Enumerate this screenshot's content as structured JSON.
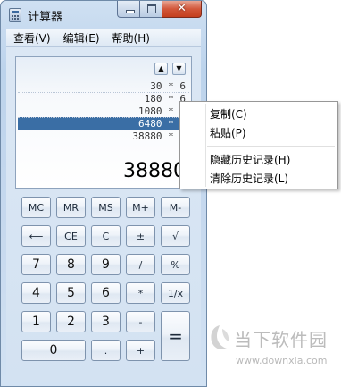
{
  "window": {
    "title": "计算器",
    "caption": {
      "minimize": "",
      "maximize": "",
      "close": "✕"
    }
  },
  "menubar": [
    {
      "label": "查看(V)"
    },
    {
      "label": "编辑(E)"
    },
    {
      "label": "帮助(H)"
    }
  ],
  "display": {
    "history_up": "▲",
    "history_down": "▼",
    "history": [
      "30 * 6",
      "180 * 6",
      "1080 * 6",
      "6480 * 6",
      "38880 * 6"
    ],
    "selected_index": 3,
    "result": "38880"
  },
  "keypad": {
    "rows": [
      [
        "MC",
        "MR",
        "MS",
        "M+",
        "M-"
      ],
      [
        "⟵",
        "CE",
        "C",
        "±",
        "√"
      ],
      [
        "7",
        "8",
        "9",
        "/",
        "%"
      ],
      [
        "4",
        "5",
        "6",
        "*",
        "1/x"
      ],
      [
        "1",
        "2",
        "3",
        "-",
        "="
      ],
      [
        "0",
        ".",
        "+"
      ]
    ]
  },
  "context_menu": {
    "items": [
      "复制(C)",
      "粘贴(P)",
      "隐藏历史记录(H)",
      "清除历史记录(L)"
    ]
  },
  "watermark": {
    "brand": "当下软件园",
    "url": "www.downxia.com"
  },
  "colors": {
    "selection": "#3a6ea5",
    "close_button": "#c43f1e",
    "frame": "#bcd3ec"
  }
}
